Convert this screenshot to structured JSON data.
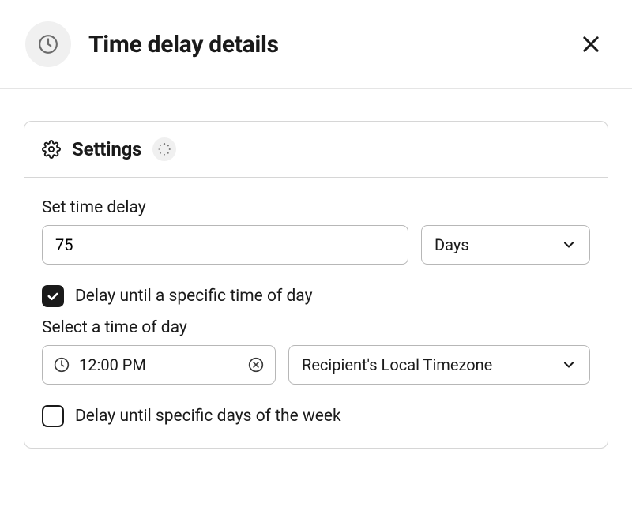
{
  "header": {
    "title": "Time delay details"
  },
  "settings": {
    "title": "Settings",
    "delay_label": "Set time delay",
    "delay_value": "75",
    "unit_selected": "Days",
    "checkbox_time_of_day_label": "Delay until a specific time of day",
    "checkbox_time_of_day_checked": true,
    "time_of_day_label": "Select a time of day",
    "time_value": "12:00 PM",
    "timezone_selected": "Recipient's Local Timezone",
    "checkbox_days_of_week_label": "Delay until specific days of the week",
    "checkbox_days_of_week_checked": false
  }
}
